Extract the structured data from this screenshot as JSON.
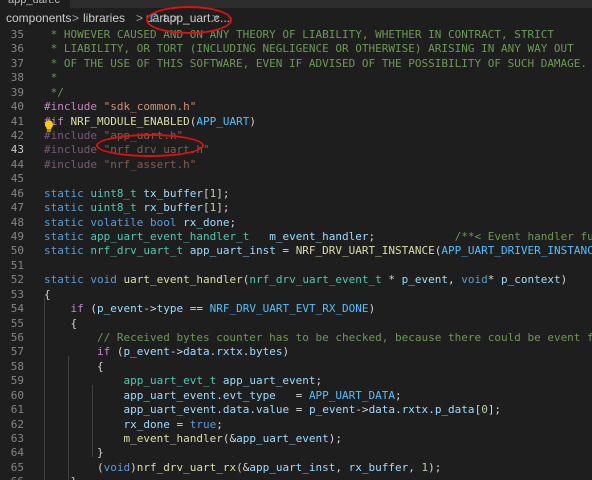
{
  "tab": {
    "label": "app_uart.c"
  },
  "breadcrumb": {
    "items": [
      "components",
      "libraries",
      "uart",
      "app_uart.c",
      "..."
    ],
    "separator": ">",
    "file_icon": "C"
  },
  "lines": [
    {
      "n": "35",
      "t": [
        [
          "c",
          " * HOWEVER CAUSED AND ON ANY THEORY OF LIABILITY, WHETHER IN CONTRACT, STRICT"
        ]
      ]
    },
    {
      "n": "36",
      "t": [
        [
          "c",
          " * LIABILITY, OR TORT (INCLUDING NEGLIGENCE OR OTHERWISE) ARISING IN ANY WAY OUT"
        ]
      ]
    },
    {
      "n": "37",
      "t": [
        [
          "c",
          " * OF THE USE OF THIS SOFTWARE, EVEN IF ADVISED OF THE POSSIBILITY OF SUCH DAMAGE."
        ]
      ]
    },
    {
      "n": "38",
      "t": [
        [
          "c",
          " *"
        ]
      ]
    },
    {
      "n": "39",
      "t": [
        [
          "c",
          " */"
        ]
      ]
    },
    {
      "n": "40",
      "t": [
        [
          "p",
          "#include"
        ],
        [
          "",
          " "
        ],
        [
          "s",
          "\"sdk_common.h\""
        ]
      ]
    },
    {
      "n": "41",
      "t": [
        [
          "p",
          "#if"
        ],
        [
          "",
          " "
        ],
        [
          "f",
          "NRF_MODULE_ENABLED"
        ],
        [
          "",
          "("
        ],
        [
          "m",
          "APP_UART"
        ],
        [
          "",
          ")"
        ]
      ]
    },
    {
      "n": "42",
      "dim": true,
      "t": [
        [
          "p",
          "#include"
        ],
        [
          "",
          " "
        ],
        [
          "s",
          "\"app_uart.h\""
        ]
      ]
    },
    {
      "n": "43",
      "dim": true,
      "active": true,
      "t": [
        [
          "p",
          "#include"
        ],
        [
          "",
          " "
        ],
        [
          "s",
          "\"nrf_drv_uart.h\""
        ]
      ]
    },
    {
      "n": "44",
      "dim": true,
      "t": [
        [
          "p",
          "#include"
        ],
        [
          "",
          " "
        ],
        [
          "s",
          "\"nrf_assert.h\""
        ]
      ]
    },
    {
      "n": "45",
      "t": []
    },
    {
      "n": "46",
      "t": [
        [
          "k",
          "static"
        ],
        [
          "",
          " "
        ],
        [
          "t",
          "uint8_t"
        ],
        [
          "",
          " "
        ],
        [
          "v",
          "tx_buffer"
        ],
        [
          "",
          "["
        ],
        [
          "n",
          "1"
        ],
        [
          "",
          "];"
        ]
      ]
    },
    {
      "n": "47",
      "t": [
        [
          "k",
          "static"
        ],
        [
          "",
          " "
        ],
        [
          "t",
          "uint8_t"
        ],
        [
          "",
          " "
        ],
        [
          "v",
          "rx_buffer"
        ],
        [
          "",
          "["
        ],
        [
          "n",
          "1"
        ],
        [
          "",
          "];"
        ]
      ]
    },
    {
      "n": "48",
      "t": [
        [
          "k",
          "static"
        ],
        [
          "",
          " "
        ],
        [
          "k",
          "volatile"
        ],
        [
          "",
          " "
        ],
        [
          "k",
          "bool"
        ],
        [
          "",
          " "
        ],
        [
          "v",
          "rx_done"
        ],
        [
          "",
          ";"
        ]
      ]
    },
    {
      "n": "49",
      "t": [
        [
          "k",
          "static"
        ],
        [
          "",
          " "
        ],
        [
          "t",
          "app_uart_event_handler_t"
        ],
        [
          "",
          "   "
        ],
        [
          "v",
          "m_event_handler"
        ],
        [
          "",
          ";"
        ],
        [
          "",
          "            "
        ],
        [
          "c",
          "/**< Event handler function. */"
        ]
      ]
    },
    {
      "n": "50",
      "t": [
        [
          "k",
          "static"
        ],
        [
          "",
          " "
        ],
        [
          "t",
          "nrf_drv_uart_t"
        ],
        [
          "",
          " "
        ],
        [
          "v",
          "app_uart_inst"
        ],
        [
          "",
          " = "
        ],
        [
          "f",
          "NRF_DRV_UART_INSTANCE"
        ],
        [
          "",
          "("
        ],
        [
          "m",
          "APP_UART_DRIVER_INSTANCE"
        ],
        [
          "",
          "));"
        ]
      ]
    },
    {
      "n": "51",
      "t": []
    },
    {
      "n": "52",
      "t": [
        [
          "k",
          "static"
        ],
        [
          "",
          " "
        ],
        [
          "k",
          "void"
        ],
        [
          "",
          " "
        ],
        [
          "f",
          "uart_event_handler"
        ],
        [
          "",
          "("
        ],
        [
          "t",
          "nrf_drv_uart_event_t"
        ],
        [
          "",
          " * "
        ],
        [
          "v",
          "p_event"
        ],
        [
          "",
          ", "
        ],
        [
          "k",
          "void"
        ],
        [
          "",
          "* "
        ],
        [
          "v",
          "p_context"
        ],
        [
          "",
          ")"
        ]
      ]
    },
    {
      "n": "53",
      "t": [
        [
          "",
          "{"
        ]
      ]
    },
    {
      "n": "54",
      "t": [
        [
          "",
          "    "
        ],
        [
          "p",
          "if"
        ],
        [
          "",
          " ("
        ],
        [
          "v",
          "p_event"
        ],
        [
          "",
          "->"
        ],
        [
          "v",
          "type"
        ],
        [
          "",
          " == "
        ],
        [
          "m",
          "NRF_DRV_UART_EVT_RX_DONE"
        ],
        [
          "",
          ")"
        ]
      ]
    },
    {
      "n": "55",
      "t": [
        [
          "",
          "    {"
        ]
      ]
    },
    {
      "n": "56",
      "t": [
        [
          "",
          "        "
        ],
        [
          "c",
          "// Received bytes counter has to be checked, because there could be event from RXTO in"
        ]
      ]
    },
    {
      "n": "57",
      "t": [
        [
          "",
          "        "
        ],
        [
          "p",
          "if"
        ],
        [
          "",
          " ("
        ],
        [
          "v",
          "p_event"
        ],
        [
          "",
          "->"
        ],
        [
          "v",
          "data"
        ],
        [
          "",
          "."
        ],
        [
          "v",
          "rxtx"
        ],
        [
          "",
          "."
        ],
        [
          "v",
          "bytes"
        ],
        [
          "",
          ")"
        ]
      ]
    },
    {
      "n": "58",
      "t": [
        [
          "",
          "        {"
        ]
      ]
    },
    {
      "n": "59",
      "t": [
        [
          "",
          "            "
        ],
        [
          "t",
          "app_uart_evt_t"
        ],
        [
          "",
          " "
        ],
        [
          "v",
          "app_uart_event"
        ],
        [
          "",
          ";"
        ]
      ]
    },
    {
      "n": "60",
      "t": [
        [
          "",
          "            "
        ],
        [
          "v",
          "app_uart_event"
        ],
        [
          "",
          "."
        ],
        [
          "v",
          "evt_type"
        ],
        [
          "",
          "   = "
        ],
        [
          "m",
          "APP_UART_DATA"
        ],
        [
          "",
          ";"
        ]
      ]
    },
    {
      "n": "61",
      "t": [
        [
          "",
          "            "
        ],
        [
          "v",
          "app_uart_event"
        ],
        [
          "",
          "."
        ],
        [
          "v",
          "data"
        ],
        [
          "",
          "."
        ],
        [
          "v",
          "value"
        ],
        [
          "",
          " = "
        ],
        [
          "v",
          "p_event"
        ],
        [
          "",
          "->"
        ],
        [
          "v",
          "data"
        ],
        [
          "",
          "."
        ],
        [
          "v",
          "rxtx"
        ],
        [
          "",
          "."
        ],
        [
          "v",
          "p_data"
        ],
        [
          "",
          "["
        ],
        [
          "n",
          "0"
        ],
        [
          "",
          "];"
        ]
      ]
    },
    {
      "n": "62",
      "t": [
        [
          "",
          "            "
        ],
        [
          "v",
          "rx_done"
        ],
        [
          "",
          " = "
        ],
        [
          "k",
          "true"
        ],
        [
          "",
          ";"
        ]
      ]
    },
    {
      "n": "63",
      "t": [
        [
          "",
          "            "
        ],
        [
          "f",
          "m_event_handler"
        ],
        [
          "",
          "(&"
        ],
        [
          "v",
          "app_uart_event"
        ],
        [
          "",
          ");"
        ]
      ]
    },
    {
      "n": "64",
      "t": [
        [
          "",
          "        }"
        ]
      ]
    },
    {
      "n": "65",
      "t": [
        [
          "",
          "        ("
        ],
        [
          "k",
          "void"
        ],
        [
          "",
          ")"
        ],
        [
          "f",
          "nrf_drv_uart_rx"
        ],
        [
          "",
          "(&"
        ],
        [
          "v",
          "app_uart_inst"
        ],
        [
          "",
          ", "
        ],
        [
          "v",
          "rx_buffer"
        ],
        [
          "",
          ", "
        ],
        [
          "n",
          "1"
        ],
        [
          "",
          ");"
        ]
      ]
    },
    {
      "n": "66",
      "t": [
        [
          "",
          "    }"
        ]
      ]
    }
  ],
  "colors": {
    "background": "#1e1e1e",
    "comment": "#6a9955",
    "keyword": "#569cd6",
    "preprocessor": "#c586c0",
    "string": "#ce9178",
    "type": "#4ec9b0",
    "variable": "#9cdcfe",
    "function": "#dcdcaa",
    "macro": "#4fc1ff",
    "number": "#b5cea8",
    "annotation": "#e01010"
  },
  "icons": {
    "lightbulb": "lightbulb-icon",
    "file": "c-file-icon"
  }
}
